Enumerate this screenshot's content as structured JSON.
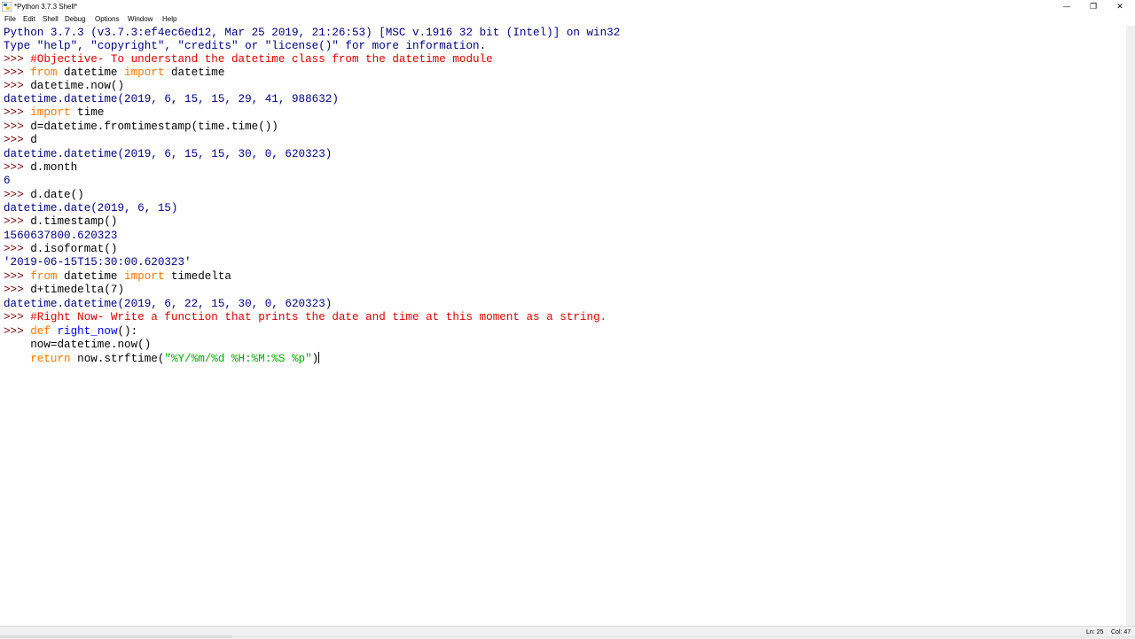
{
  "window": {
    "title": "*Python 3.7.3 Shell*",
    "minimize_glyph": "—",
    "restore_glyph": "❐",
    "close_glyph": "✕"
  },
  "menu": [
    "File",
    "Edit",
    "Shell",
    "Debug",
    "Options",
    "Window",
    "Help"
  ],
  "shell": {
    "prompt": ">>> ",
    "banner1": "Python 3.7.3 (v3.7.3:ef4ec6ed12, Mar 25 2019, 21:26:53) [MSC v.1916 32 bit (Intel)] on win32",
    "banner2": "Type \"help\", \"copyright\", \"credits\" or \"license()\" for more information.",
    "l3_comment": "#Objective- To understand the datetime class from the datetime module",
    "l4_from": "from",
    "l4_mid": " datetime ",
    "l4_import": "import",
    "l4_end": " datetime",
    "l5": "datetime.now()",
    "l6_out": "datetime.datetime(2019, 6, 15, 15, 29, 41, 988632)",
    "l7_import": "import",
    "l7_end": " time",
    "l8": "d=datetime.fromtimestamp(time.time())",
    "l9": "d",
    "l10_out": "datetime.datetime(2019, 6, 15, 15, 30, 0, 620323)",
    "l11": "d.month",
    "l12_out": "6",
    "l13": "d.date()",
    "l14_out": "datetime.date(2019, 6, 15)",
    "l15": "d.timestamp()",
    "l16_out": "1560637800.620323",
    "l17": "d.isoformat()",
    "l18_out": "'2019-06-15T15:30:00.620323'",
    "l19_from": "from",
    "l19_mid": " datetime ",
    "l19_import": "import",
    "l19_end": " timedelta",
    "l20": "d+timedelta(7)",
    "l21_out": "datetime.datetime(2019, 6, 22, 15, 30, 0, 620323)",
    "l22_comment": "#Right Now- Write a function that prints the date and time at this moment as a string.",
    "l23_def": "def",
    "l23_name": " right_now",
    "l23_end": "():",
    "l24": "    now=datetime.now()",
    "l25_indent": "    ",
    "l25_return": "return",
    "l25_mid": " now.strftime(",
    "l25_str": "\"%Y/%m/%d %H:%M:%S %p\"",
    "l25_end": ")"
  },
  "status": {
    "line": "Ln: 25",
    "col": "Col: 47"
  },
  "colors": {
    "prompt": "#770000",
    "output": "#000080",
    "keyword": "#ff7700",
    "comment": "#dd0000",
    "string": "#00aa00",
    "definition": "#0000ff"
  }
}
